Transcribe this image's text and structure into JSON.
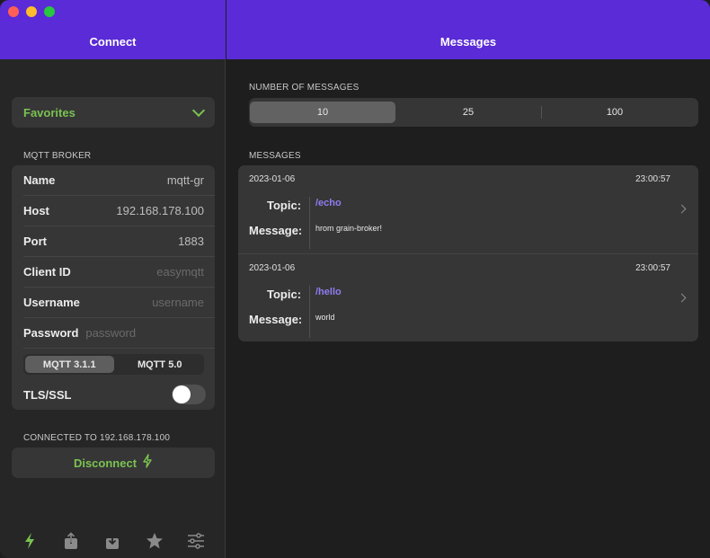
{
  "left": {
    "title": "Connect",
    "favorites_label": "Favorites",
    "broker_section": "MQTT BROKER",
    "fields": [
      {
        "key": "Name",
        "value": "mqtt-gr"
      },
      {
        "key": "Host",
        "value": "192.168.178.100"
      },
      {
        "key": "Port",
        "value": "1883"
      },
      {
        "key": "Client ID",
        "placeholder": "easymqtt"
      },
      {
        "key": "Username",
        "placeholder": "username"
      },
      {
        "key": "Password",
        "placeholder": "password"
      }
    ],
    "protocol": {
      "options": [
        "MQTT 3.1.1",
        "MQTT 5.0"
      ],
      "selected": "MQTT 3.1.1"
    },
    "tls": {
      "label": "TLS/SSL",
      "enabled": false
    },
    "status": "CONNECTED TO 192.168.178.100",
    "disconnect_label": "Disconnect",
    "toolbar": [
      "bolt-icon",
      "share-icon",
      "import-icon",
      "star-icon",
      "sliders-icon"
    ]
  },
  "right": {
    "title": "Messages",
    "count_section": "NUMBER OF MESSAGES",
    "count_options": [
      "10",
      "25",
      "100"
    ],
    "count_selected": "10",
    "messages_section": "MESSAGES",
    "topic_label": "Topic:",
    "message_label": "Message:",
    "messages": [
      {
        "date": "2023-01-06",
        "time": "23:00:57",
        "topic": "/echo",
        "message": "hrom grain-broker!"
      },
      {
        "date": "2023-01-06",
        "time": "23:00:57",
        "topic": "/hello",
        "message": "world"
      }
    ]
  },
  "colors": {
    "header": "#5a2bd6",
    "accent_green": "#7ac251",
    "topic_purple": "#8e7cf0"
  }
}
